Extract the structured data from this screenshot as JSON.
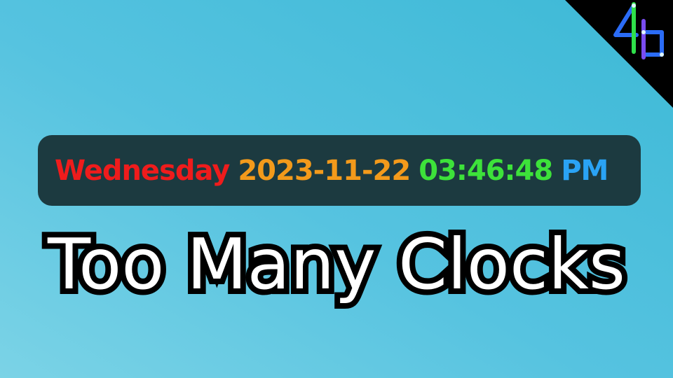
{
  "clock": {
    "day": "Wednesday",
    "date": "2023-11-22",
    "time": "03:46:48",
    "ampm": "PM"
  },
  "title": "Too Many Clocks",
  "logo": {
    "icon": "4b-logo-icon",
    "colors": [
      "#2b6cf6",
      "#2fe04a",
      "#7a4cf0"
    ]
  },
  "colors": {
    "day": "#ef1c1c",
    "date": "#f39a1b",
    "time": "#3de23a",
    "ampm": "#2aa3f5",
    "bar_background": "#1c3a40"
  }
}
